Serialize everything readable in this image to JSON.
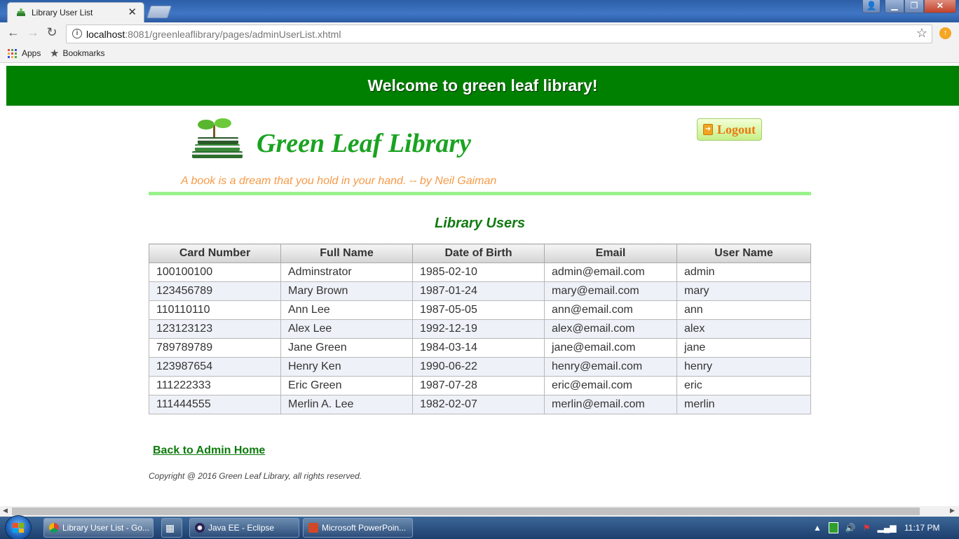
{
  "browser": {
    "tab_title": "Library User List",
    "url_host": "localhost",
    "url_rest": ":8081/greenleaflibrary/pages/adminUserList.xhtml",
    "bookmarks": [
      "Apps",
      "Bookmarks"
    ]
  },
  "page": {
    "banner": "Welcome to green leaf library!",
    "site_title": "Green Leaf Library",
    "logout_label": "Logout",
    "quote": "A book is a dream that you hold in your hand. -- by Neil Gaiman",
    "section_title": "Library Users",
    "table": {
      "columns": [
        "Card Number",
        "Full Name",
        "Date of Birth",
        "Email",
        "User Name"
      ],
      "rows": [
        [
          "100100100",
          "Adminstrator",
          "1985-02-10",
          "admin@email.com",
          "admin"
        ],
        [
          "123456789",
          "Mary Brown",
          "1987-01-24",
          "mary@email.com",
          "mary"
        ],
        [
          "110110110",
          "Ann Lee",
          "1987-05-05",
          "ann@email.com",
          "ann"
        ],
        [
          "123123123",
          "Alex Lee",
          "1992-12-19",
          "alex@email.com",
          "alex"
        ],
        [
          "789789789",
          "Jane Green",
          "1984-03-14",
          "jane@email.com",
          "jane"
        ],
        [
          "123987654",
          "Henry Ken",
          "1990-06-22",
          "henry@email.com",
          "henry"
        ],
        [
          "111222333",
          "Eric Green",
          "1987-07-28",
          "eric@email.com",
          "eric"
        ],
        [
          "111444555",
          "Merlin A. Lee",
          "1982-02-07",
          "merlin@email.com",
          "merlin"
        ]
      ]
    },
    "back_link": "Back to Admin Home",
    "copyright": "Copyright @ 2016 Green Leaf Library, all rights reserved."
  },
  "taskbar": {
    "items": [
      "Library User List - Go...",
      "Java EE - Eclipse",
      "Microsoft PowerPoin..."
    ],
    "clock": "11:17 PM"
  },
  "colors": {
    "banner_green": "#008000",
    "title_green": "#1aa321",
    "quote_orange": "#f59a48",
    "divider_green": "#99f28c"
  }
}
